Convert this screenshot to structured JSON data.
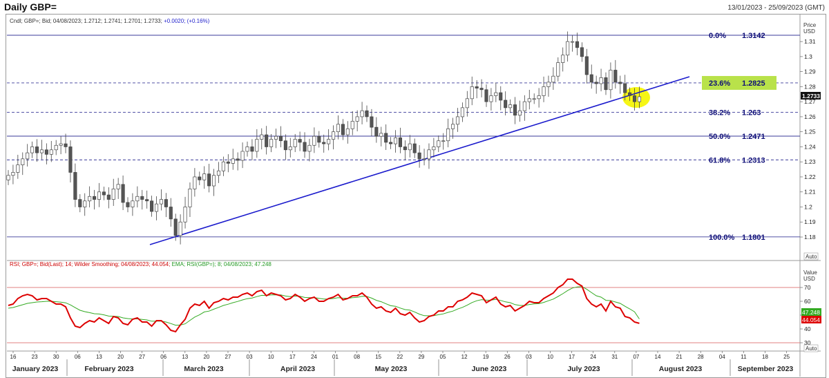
{
  "header": {
    "title": "Daily GBP=",
    "date_range": "13/01/2023 - 25/09/2023 (GMT)"
  },
  "price_panel": {
    "legend": [
      "Cndl; GBP=; Bid; 04/08/2023; 1.2712; 1.2741; 1.2701; 1.2733; ",
      "+0.0020; (+0.16%)"
    ],
    "axis_title": [
      "Price",
      "USD"
    ],
    "yticks": [
      1.18,
      1.19,
      1.2,
      1.21,
      1.22,
      1.23,
      1.24,
      1.25,
      1.26,
      1.27,
      1.28,
      1.29,
      1.3,
      1.31
    ],
    "ylim": [
      1.174,
      1.3215
    ],
    "last_price_label": "1.2733",
    "auto_label": "Auto",
    "colors": {
      "candle": "#555555",
      "trendline": "#1a1acc",
      "fib": "#3a3a99",
      "fib_text": "#0d0d77",
      "highlight_fill": "#b9e24a",
      "circle_fill": "#f5f50a"
    }
  },
  "fibonacci": [
    {
      "label": "0.0%",
      "value": "1.3142",
      "level": 1.3142,
      "dashed": false,
      "highlight": false
    },
    {
      "label": "23.6%",
      "value": "1.2825",
      "level": 1.2825,
      "dashed": true,
      "highlight": true
    },
    {
      "label": "38.2%",
      "value": "1.263",
      "level": 1.263,
      "dashed": true,
      "highlight": false
    },
    {
      "label": "50.0%",
      "value": "1.2471",
      "level": 1.2471,
      "dashed": false,
      "highlight": false
    },
    {
      "label": "61.8%",
      "value": "1.2313",
      "level": 1.2313,
      "dashed": true,
      "highlight": false
    },
    {
      "label": "100.0%",
      "value": "1.1801",
      "level": 1.1801,
      "dashed": false,
      "highlight": false
    }
  ],
  "rsi_panel": {
    "legend_red": "RSI; GBP=; Bid(Last); 14; Wilder Smoothing; 04/08/2023; 44.054; ",
    "legend_green": "EMA; RSI(GBP=); 8; 04/08/2023; 47.248",
    "axis_title": [
      "Value",
      "USD"
    ],
    "yticks": [
      30,
      40,
      50,
      60,
      70
    ],
    "ylim": [
      27,
      82
    ],
    "levels": [
      30,
      70
    ],
    "rsi_last": "44.054",
    "ema_last": "47.248",
    "auto_label": "Auto",
    "colors": {
      "rsi": "#dd0000",
      "ema": "#33aa22",
      "level": "#e08080"
    }
  },
  "time_axis": {
    "day_ticks": [
      "16",
      "23",
      "30",
      "06",
      "13",
      "20",
      "27",
      "06",
      "13",
      "20",
      "27",
      "03",
      "10",
      "17",
      "24",
      "01",
      "08",
      "15",
      "22",
      "29",
      "05",
      "12",
      "19",
      "26",
      "03",
      "10",
      "17",
      "24",
      "31",
      "07",
      "14",
      "21",
      "28",
      "04",
      "11",
      "18",
      "25"
    ],
    "months": [
      "January 2023",
      "February 2023",
      "March 2023",
      "April 2023",
      "May 2023",
      "June 2023",
      "July 2023",
      "August 2023",
      "September 2023"
    ]
  },
  "chart_data": [
    {
      "type": "candlestick",
      "title": "Daily GBP=",
      "ylabel": "Price USD",
      "ylim": [
        1.174,
        1.3215
      ],
      "x_start": "2023-01-13",
      "x_end": "2023-08-04",
      "close_approx": [
        1.221,
        1.223,
        1.228,
        1.232,
        1.236,
        1.24,
        1.236,
        1.238,
        1.235,
        1.238,
        1.241,
        1.242,
        1.24,
        1.223,
        1.205,
        1.2,
        1.204,
        1.207,
        1.205,
        1.21,
        1.208,
        1.205,
        1.212,
        1.215,
        1.203,
        1.2,
        1.204,
        1.207,
        1.205,
        1.204,
        1.197,
        1.202,
        1.205,
        1.2,
        1.192,
        1.181,
        1.19,
        1.2,
        1.212,
        1.22,
        1.218,
        1.222,
        1.214,
        1.221,
        1.224,
        1.23,
        1.229,
        1.232,
        1.231,
        1.237,
        1.24,
        1.237,
        1.245,
        1.248,
        1.24,
        1.245,
        1.247,
        1.244,
        1.238,
        1.24,
        1.245,
        1.243,
        1.237,
        1.241,
        1.247,
        1.243,
        1.242,
        1.245,
        1.25,
        1.255,
        1.248,
        1.252,
        1.257,
        1.26,
        1.264,
        1.26,
        1.253,
        1.247,
        1.249,
        1.243,
        1.242,
        1.246,
        1.24,
        1.238,
        1.242,
        1.236,
        1.232,
        1.232,
        1.238,
        1.24,
        1.244,
        1.244,
        1.252,
        1.255,
        1.26,
        1.266,
        1.272,
        1.28,
        1.279,
        1.278,
        1.27,
        1.274,
        1.276,
        1.271,
        1.266,
        1.268,
        1.261,
        1.264,
        1.27,
        1.272,
        1.272,
        1.274,
        1.28,
        1.283,
        1.287,
        1.296,
        1.301,
        1.31,
        1.31,
        1.306,
        1.3,
        1.288,
        1.283,
        1.282,
        1.286,
        1.278,
        1.291,
        1.283,
        1.282,
        1.276,
        1.274,
        1.27,
        1.2733
      ]
    },
    {
      "type": "line",
      "title": "RSI; GBP=; Bid(Last); 14; Wilder Smoothing",
      "ylabel": "Value USD",
      "ylim": [
        27,
        82
      ],
      "series": [
        {
          "name": "RSI(GBP=) 14",
          "values": [
            57,
            58,
            62,
            64,
            65,
            64,
            61,
            62,
            62,
            60,
            58,
            58,
            56,
            48,
            42,
            41,
            44,
            46,
            45,
            48,
            46,
            44,
            49,
            48,
            44,
            43,
            47,
            48,
            45,
            45,
            42,
            46,
            46,
            43,
            39,
            38,
            43,
            47,
            55,
            58,
            57,
            60,
            55,
            59,
            60,
            62,
            61,
            63,
            63,
            65,
            66,
            64,
            67,
            68,
            64,
            66,
            65,
            64,
            61,
            62,
            65,
            63,
            60,
            62,
            63,
            60,
            60,
            62,
            63,
            65,
            61,
            62,
            64,
            64,
            66,
            63,
            58,
            55,
            56,
            53,
            52,
            55,
            51,
            50,
            52,
            48,
            45,
            46,
            49,
            50,
            53,
            53,
            56,
            56,
            60,
            61,
            63,
            66,
            65,
            64,
            59,
            61,
            63,
            58,
            56,
            57,
            53,
            55,
            57,
            60,
            59,
            59,
            62,
            64,
            66,
            70,
            72,
            76,
            76,
            73,
            71,
            62,
            58,
            56,
            58,
            53,
            60,
            56,
            55,
            49,
            48,
            45,
            44.054
          ]
        },
        {
          "name": "EMA(RSI(GBP=)) 8",
          "values": [
            55,
            55.5,
            56.5,
            57.5,
            58.5,
            59,
            59.5,
            59.7,
            60,
            60,
            59.7,
            59.4,
            58.9,
            57.4,
            55.4,
            53.5,
            52.5,
            51.8,
            51,
            50.8,
            50.2,
            49.3,
            49.2,
            49,
            48,
            47.5,
            47.2,
            47.3,
            46.9,
            46.5,
            45.6,
            45.6,
            45.6,
            45,
            43.9,
            42.7,
            42.8,
            43.7,
            46.2,
            48.6,
            50.2,
            52.3,
            52.9,
            54.3,
            55.6,
            57,
            57.9,
            59,
            59.9,
            61,
            61.9,
            62.4,
            63.4,
            64.3,
            64.2,
            64.6,
            64.7,
            64.6,
            63.8,
            63.4,
            63.8,
            63.6,
            62.8,
            62.6,
            62.7,
            62.1,
            61.6,
            61.7,
            62,
            62.6,
            62.3,
            62.2,
            62.6,
            62.9,
            63.6,
            63.5,
            62.3,
            60.7,
            59.7,
            58.2,
            56.8,
            56.4,
            55.1,
            54,
            53.6,
            52.3,
            50.7,
            49.6,
            49.5,
            49.6,
            50.3,
            50.9,
            52,
            52.9,
            54.4,
            55.6,
            57.2,
            59.1,
            60.4,
            61.2,
            60.8,
            60.9,
            61.4,
            60.6,
            59.6,
            59,
            57.6,
            57,
            57,
            57.7,
            58.1,
            58.3,
            59.2,
            60.4,
            61.6,
            63.5,
            65.5,
            67.8,
            69.6,
            70.4,
            70.6,
            68.7,
            66.3,
            64,
            63,
            60.7,
            60.5,
            59.5,
            58.5,
            56.4,
            54.5,
            52.4,
            47.248
          ]
        }
      ],
      "levels": [
        30,
        70
      ]
    }
  ]
}
